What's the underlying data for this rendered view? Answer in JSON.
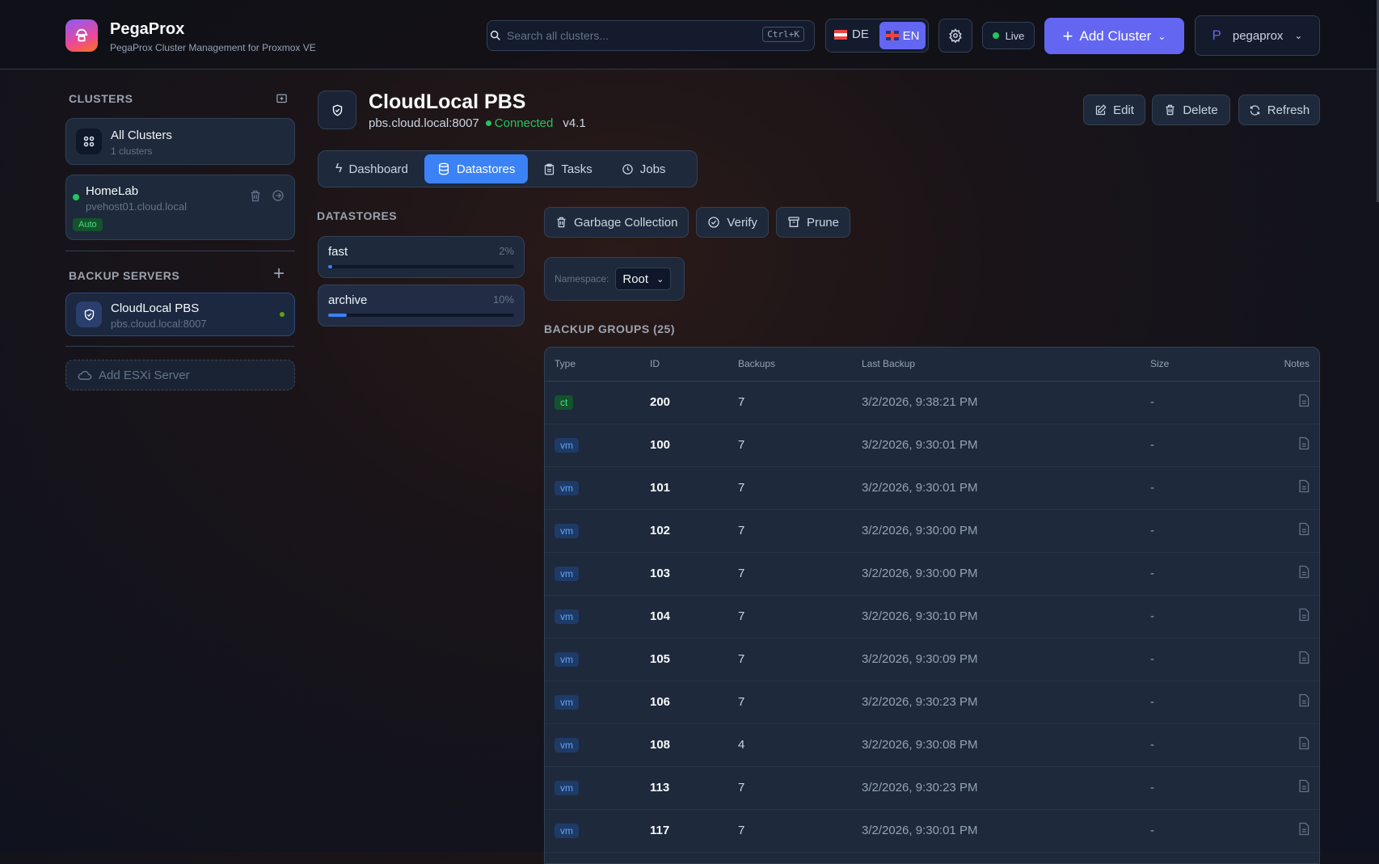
{
  "header": {
    "app_name": "PegaProx",
    "app_subtitle": "PegaProx Cluster Management for Proxmox VE",
    "search_placeholder": "Search all clusters...",
    "search_shortcut": "Ctrl+K",
    "lang_de": "DE",
    "lang_en": "EN",
    "live_label": "Live",
    "add_cluster": "Add Cluster",
    "user_initial": "P",
    "user_name": "pegaprox"
  },
  "sidebar": {
    "clusters_title": "CLUSTERS",
    "all_clusters": {
      "name": "All Clusters",
      "count": "1 clusters"
    },
    "clusters": [
      {
        "name": "HomeLab",
        "host": "pvehost01.cloud.local",
        "badge": "Auto"
      }
    ],
    "backup_title": "BACKUP SERVERS",
    "backup_servers": [
      {
        "name": "CloudLocal PBS",
        "host": "pbs.cloud.local:8007"
      }
    ],
    "add_esxi": "Add ESXi Server"
  },
  "server": {
    "name": "CloudLocal PBS",
    "host": "pbs.cloud.local:8007",
    "status": "Connected",
    "version": "v4.1",
    "edit": "Edit",
    "delete": "Delete",
    "refresh": "Refresh"
  },
  "tabs": [
    {
      "label": "Dashboard"
    },
    {
      "label": "Datastores"
    },
    {
      "label": "Tasks"
    },
    {
      "label": "Jobs"
    }
  ],
  "datastores": {
    "title": "DATASTORES",
    "items": [
      {
        "name": "fast",
        "usage_label": "2%",
        "usage": 2
      },
      {
        "name": "archive",
        "usage_label": "10%",
        "usage": 10
      }
    ]
  },
  "actions": {
    "gc": "Garbage Collection",
    "verify": "Verify",
    "prune": "Prune"
  },
  "namespace": {
    "label": "Namespace:",
    "value": "Root"
  },
  "groups": {
    "title": "BACKUP GROUPS (25)",
    "columns": [
      "Type",
      "ID",
      "Backups",
      "Last Backup",
      "Size",
      "Notes"
    ],
    "rows": [
      {
        "type": "ct",
        "id": "200",
        "backups": "7",
        "last": "3/2/2026, 9:38:21 PM",
        "size": "-"
      },
      {
        "type": "vm",
        "id": "100",
        "backups": "7",
        "last": "3/2/2026, 9:30:01 PM",
        "size": "-"
      },
      {
        "type": "vm",
        "id": "101",
        "backups": "7",
        "last": "3/2/2026, 9:30:01 PM",
        "size": "-"
      },
      {
        "type": "vm",
        "id": "102",
        "backups": "7",
        "last": "3/2/2026, 9:30:00 PM",
        "size": "-"
      },
      {
        "type": "vm",
        "id": "103",
        "backups": "7",
        "last": "3/2/2026, 9:30:00 PM",
        "size": "-"
      },
      {
        "type": "vm",
        "id": "104",
        "backups": "7",
        "last": "3/2/2026, 9:30:10 PM",
        "size": "-"
      },
      {
        "type": "vm",
        "id": "105",
        "backups": "7",
        "last": "3/2/2026, 9:30:09 PM",
        "size": "-"
      },
      {
        "type": "vm",
        "id": "106",
        "backups": "7",
        "last": "3/2/2026, 9:30:23 PM",
        "size": "-"
      },
      {
        "type": "vm",
        "id": "108",
        "backups": "4",
        "last": "3/2/2026, 9:30:08 PM",
        "size": "-"
      },
      {
        "type": "vm",
        "id": "113",
        "backups": "7",
        "last": "3/2/2026, 9:30:23 PM",
        "size": "-"
      },
      {
        "type": "vm",
        "id": "117",
        "backups": "7",
        "last": "3/2/2026, 9:30:01 PM",
        "size": "-"
      }
    ]
  },
  "colors": {
    "accent": "#6366f1",
    "tab_active": "#3b82f6",
    "status_green": "#22c55e"
  }
}
